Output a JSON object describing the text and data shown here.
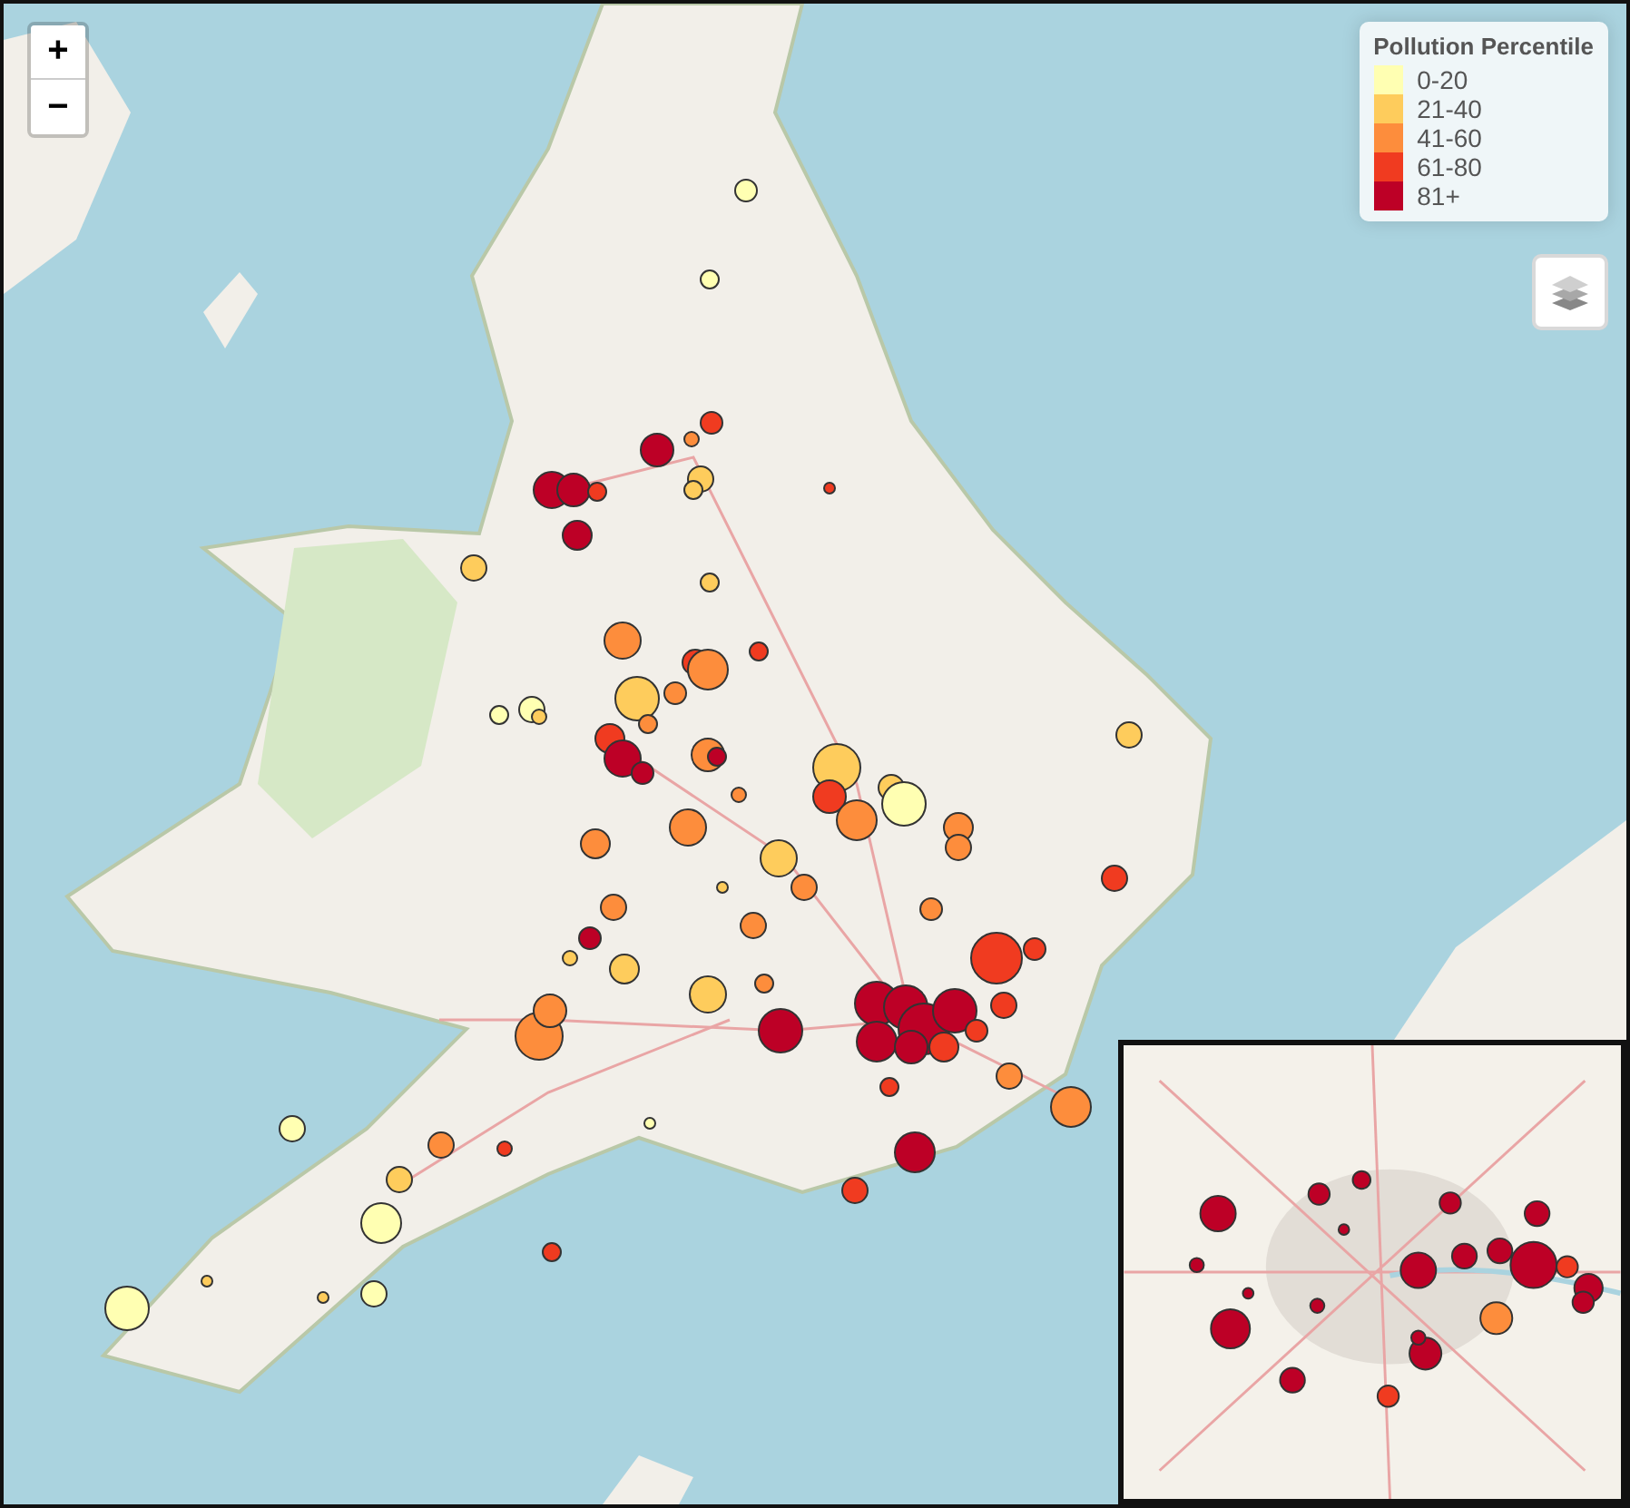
{
  "zoom_controls": [
    {
      "kind": "in",
      "label": "+"
    },
    {
      "kind": "out",
      "label": "−"
    }
  ],
  "legend": {
    "title": "Pollution Percentile",
    "items": [
      {
        "label": "0-20",
        "color": "#ffffb2"
      },
      {
        "label": "21-40",
        "color": "#fecc5c"
      },
      {
        "label": "41-60",
        "color": "#fd8d3c"
      },
      {
        "label": "61-80",
        "color": "#f03b20"
      },
      {
        "label": "81+",
        "color": "#bd0026"
      }
    ]
  }
}
